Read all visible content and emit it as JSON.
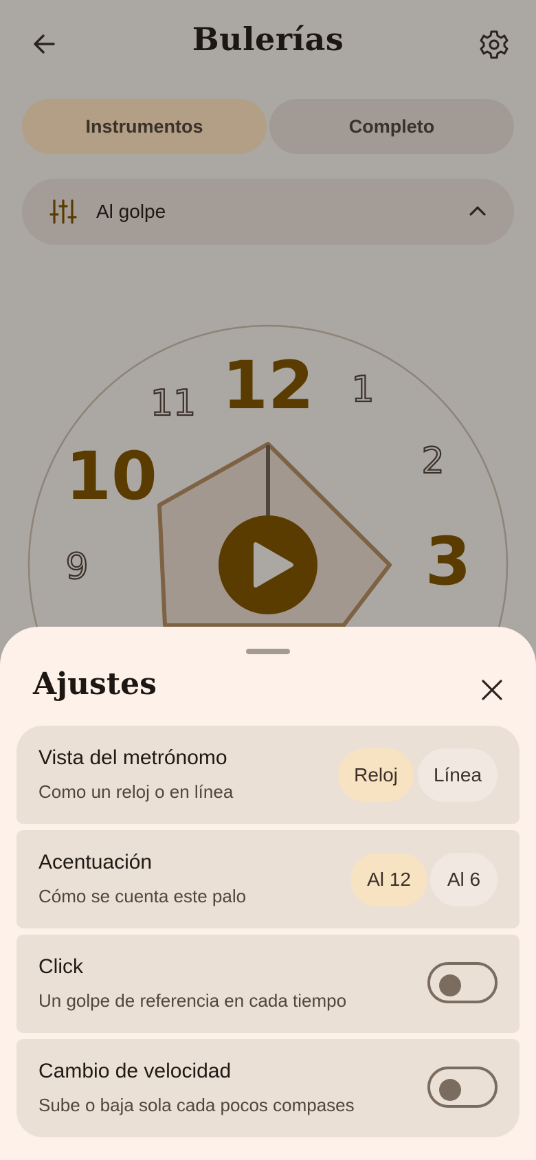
{
  "header": {
    "title": "Bulerías",
    "back_icon": "arrow-left-icon",
    "settings_icon": "gear-icon"
  },
  "tabs": [
    {
      "label": "Instrumentos",
      "selected": true
    },
    {
      "label": "Completo",
      "selected": false
    }
  ],
  "preset": {
    "label": "Al golpe",
    "icon": "sliders-icon",
    "chevron_icon": "chevron-up-icon"
  },
  "clock": {
    "numbers": [
      "12",
      "1",
      "2",
      "3",
      "9",
      "10",
      "11"
    ],
    "accented": [
      "12",
      "3",
      "10"
    ],
    "play_icon": "play-icon"
  },
  "settings": {
    "title": "Ajustes",
    "close_icon": "close-icon",
    "rows": [
      {
        "title": "Vista del metrónomo",
        "subtitle": "Como un reloj o en línea",
        "options": [
          "Reloj",
          "Línea"
        ],
        "selected": "Reloj"
      },
      {
        "title": "Acentuación",
        "subtitle": "Cómo se cuenta este palo",
        "options": [
          "Al 12",
          "Al 6"
        ],
        "selected": "Al 12"
      },
      {
        "title": "Click",
        "subtitle": "Un golpe de referencia en cada tiempo",
        "toggle": false
      },
      {
        "title": "Cambio de velocidad",
        "subtitle": "Sube o baja sola cada pocos compases",
        "toggle": false
      }
    ]
  },
  "colors": {
    "accent": "#5a3c00",
    "scrim": "#aba7a3",
    "sheet": "#fdf1e9",
    "card": "#ebe0d6",
    "chip_selected": "#f7e2c2"
  }
}
